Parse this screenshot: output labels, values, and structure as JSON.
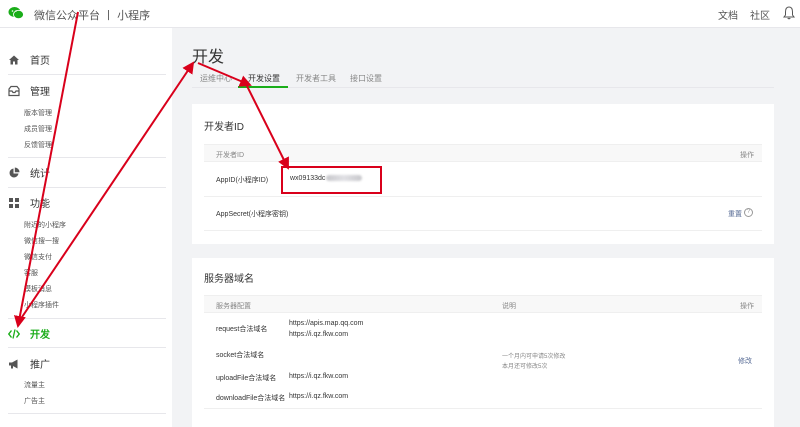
{
  "topbar": {
    "brand": "微信公众平台 丨 小程序",
    "links": [
      "文档",
      "社区"
    ]
  },
  "sidebar": {
    "groups": [
      {
        "label": "首页",
        "icon": "home-icon",
        "items": []
      },
      {
        "label": "管理",
        "icon": "inbox-icon",
        "items": [
          "版本管理",
          "成员管理",
          "反馈管理"
        ]
      },
      {
        "label": "统计",
        "icon": "pie-chart-icon",
        "items": []
      },
      {
        "label": "功能",
        "icon": "grid-icon",
        "items": [
          "附近的小程序",
          "微信搜一搜",
          "微信支付",
          "客服",
          "模板消息",
          "小程序插件"
        ]
      },
      {
        "label": "开发",
        "icon": "code-icon",
        "items": [],
        "active": true
      },
      {
        "label": "推广",
        "icon": "megaphone-icon",
        "items": [
          "流量主",
          "广告主"
        ]
      }
    ]
  },
  "main": {
    "title": "开发",
    "tabs": [
      "运维中心",
      "开发设置",
      "开发者工具",
      "接口设置"
    ],
    "active_tab": "开发设置"
  },
  "dev_id_card": {
    "title": "开发者ID",
    "col_id": "开发者ID",
    "col_action": "操作",
    "rows": [
      {
        "label": "AppID(小程序ID)",
        "value": "wx09133dc"
      },
      {
        "label": "AppSecret(小程序密钥)",
        "value": "",
        "action": "重置"
      }
    ]
  },
  "server_card": {
    "title": "服务器域名",
    "col_config": "服务器配置",
    "col_desc": "说明",
    "col_action": "操作",
    "rows": [
      {
        "label": "request合法域名",
        "values": [
          "https://apis.map.qq.com",
          "https://i.qz.fkw.com"
        ]
      },
      {
        "label": "socket合法域名",
        "values": []
      },
      {
        "label": "uploadFile合法域名",
        "values": [
          "https://i.qz.fkw.com"
        ]
      },
      {
        "label": "downloadFile合法域名",
        "values": [
          "https://i.qz.fkw.com"
        ]
      }
    ],
    "notes": [
      "一个月内可申请5次修改",
      "本月还可修改5次"
    ],
    "action": "修改"
  },
  "colors": {
    "accent": "#1aad19",
    "annotation": "#d9001b",
    "link": "#576b95"
  }
}
